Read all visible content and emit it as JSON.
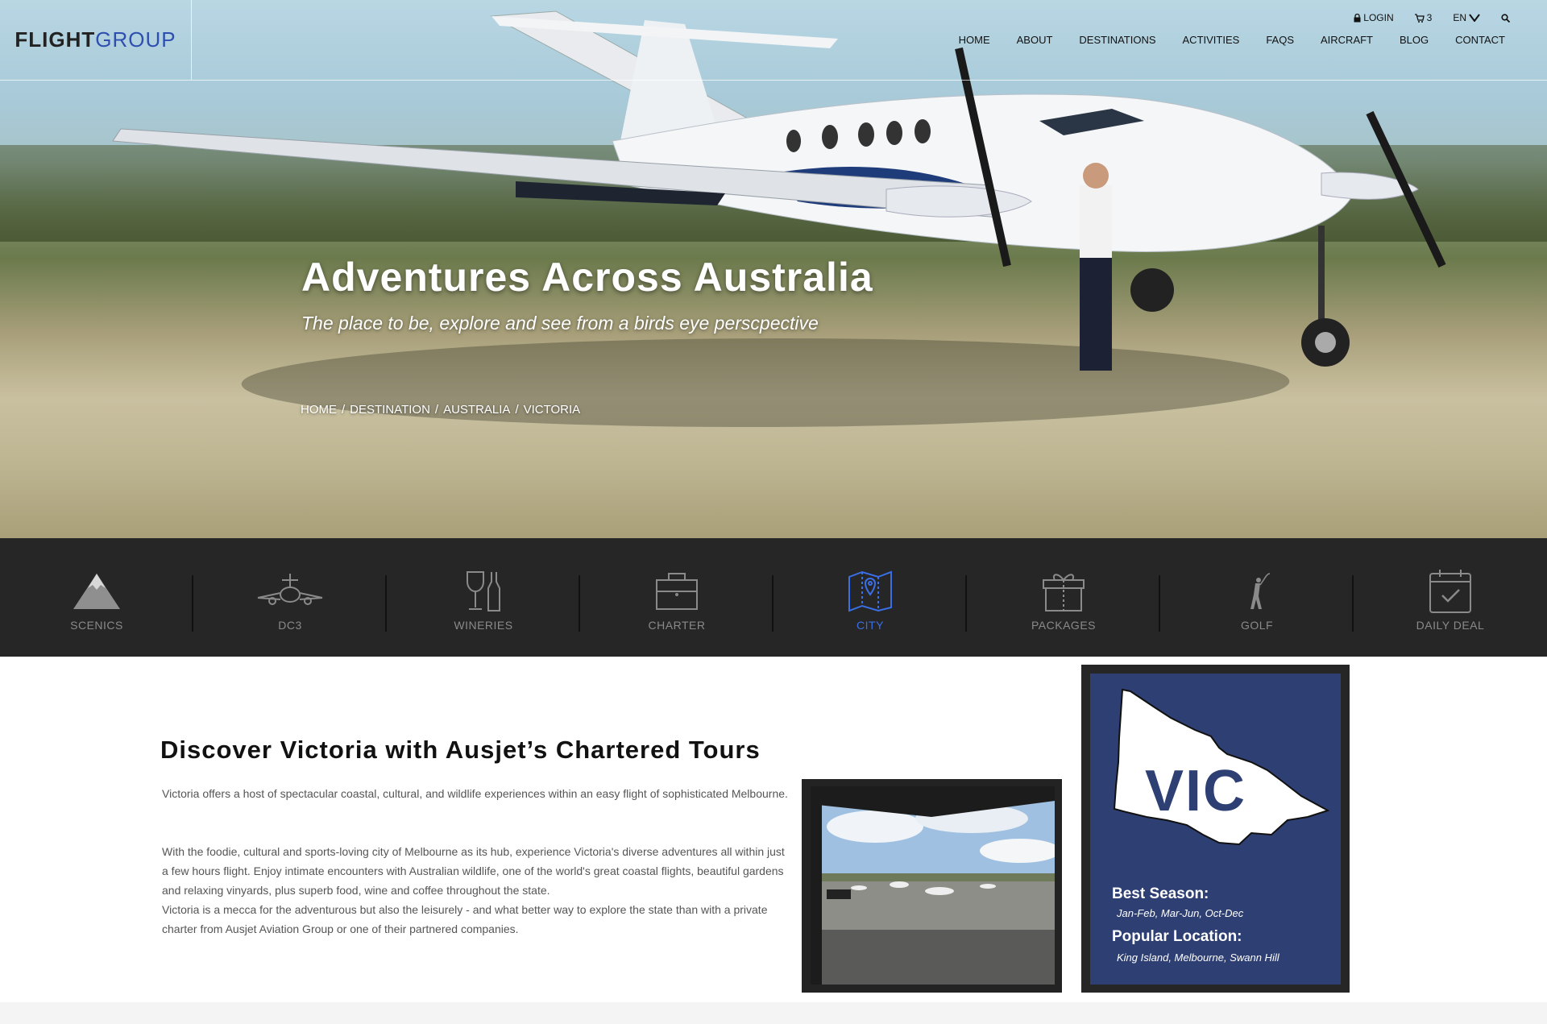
{
  "brand": {
    "logo_part1": "FLIGHT",
    "logo_part2": "GROUP"
  },
  "utility": {
    "login": "LOGIN",
    "cart_count": "3",
    "language": "EN"
  },
  "nav": [
    "HOME",
    "ABOUT",
    "DESTINATIONS",
    "ACTIVITIES",
    "FAQS",
    "AIRCRAFT",
    "BLOG",
    "CONTACT"
  ],
  "hero": {
    "title": "Adventures Across Australia",
    "subtitle": "The place to be, explore and see from a birds eye perscpective",
    "breadcrumb": [
      "HOME",
      "/",
      "DESTINATION",
      "/",
      "AUSTRALIA",
      "/",
      "VICTORIA"
    ]
  },
  "categories": [
    {
      "label": "SCENICS",
      "icon": "mountain-icon",
      "active": false
    },
    {
      "label": "DC3",
      "icon": "airplane-icon",
      "active": false
    },
    {
      "label": "WINERIES",
      "icon": "wine-glass-bottle-icon",
      "active": false
    },
    {
      "label": "CHARTER",
      "icon": "briefcase-icon",
      "active": false
    },
    {
      "label": "CITY",
      "icon": "map-pin-icon",
      "active": true
    },
    {
      "label": "PACKAGES",
      "icon": "gift-box-icon",
      "active": false
    },
    {
      "label": "GOLF",
      "icon": "golfer-icon",
      "active": false
    },
    {
      "label": "DAILY DEAL",
      "icon": "calendar-check-icon",
      "active": false
    }
  ],
  "content": {
    "heading": "Discover Victoria with Ausjet’s Chartered Tours",
    "para1": "Victoria offers a host of spectacular coastal, cultural, and wildlife experiences within an easy flight of sophisticated Melbourne.",
    "para2": "With the foodie, cultural and sports-loving city of Melbourne as its hub, experience Victoria's diverse adventures all within just a few hours flight. Enjoy intimate encounters with Australian wildlife, one of the world's great coastal flights, beautiful gardens and relaxing vinyards, plus superb food, wine and coffee throughout the state.",
    "para3": "Victoria is a mecca for the adventurous but also the leisurely - and what better way to explore the state than with a private charter from Ausjet Aviation Group or one of their partnered companies."
  },
  "state_card": {
    "abbr": "VIC",
    "season_label": "Best Season:",
    "season_value": "Jan-Feb, Mar-Jun, Oct-Dec",
    "location_label": "Popular Location:",
    "location_value": "King Island, Melbourne, Swann Hill"
  },
  "colors": {
    "accent": "#3a6fe8",
    "card": "#2e3f73",
    "bar": "#262626",
    "logo_blue": "#2f4fb0"
  }
}
